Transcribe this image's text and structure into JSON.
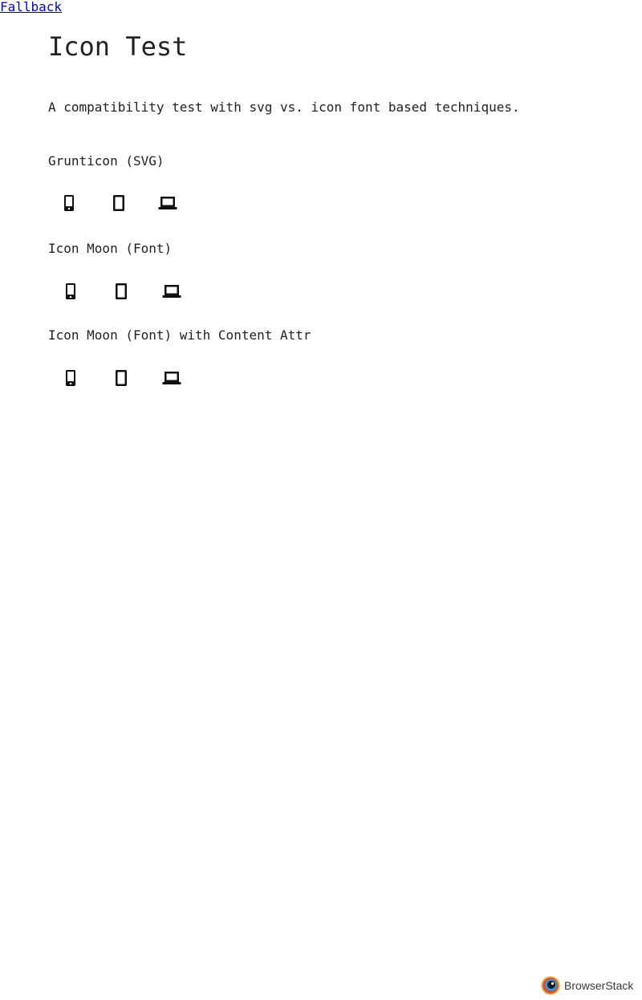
{
  "fallback_link": "Fallback",
  "title": "Icon Test",
  "intro": "A compatibility test with svg vs. icon font based techniques.",
  "sections": [
    {
      "label": "Grunticon (SVG)",
      "icons": [
        "phone-icon",
        "tablet-icon",
        "laptop-icon"
      ]
    },
    {
      "label": "Icon Moon (Font)",
      "icons": [
        "phone-icon",
        "tablet-icon",
        "laptop-icon"
      ]
    },
    {
      "label": "Icon Moon (Font) with Content Attr",
      "icons": [
        "phone-icon",
        "tablet-icon",
        "laptop-icon"
      ]
    }
  ],
  "footer_badge": {
    "text": "BrowserStack",
    "logo": "browserstack-logo"
  },
  "colors": {
    "text": "#222222",
    "link": "#0000ee",
    "icon": "#111111",
    "background": "#ffffff"
  }
}
